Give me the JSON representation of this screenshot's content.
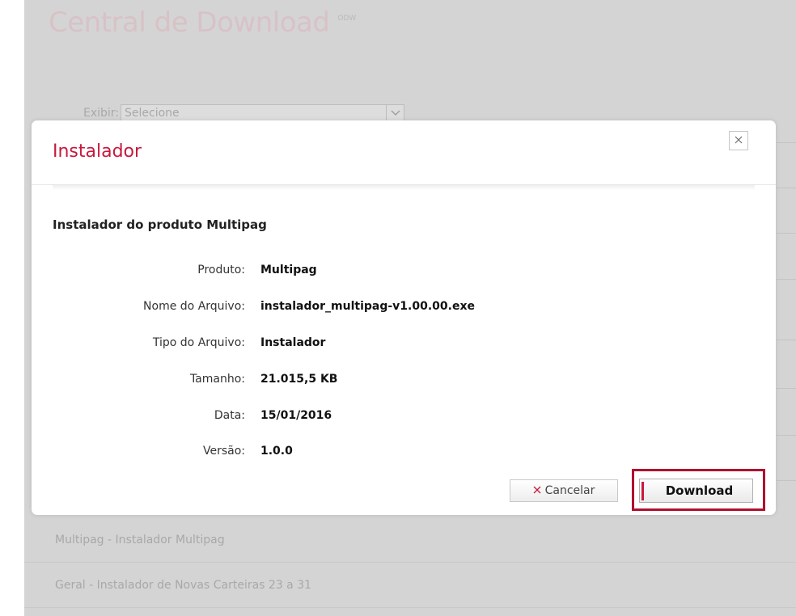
{
  "page": {
    "title": "Central de Download",
    "title_sup": "ODW",
    "filter": {
      "label": "Exibir:",
      "selected": "Selecione"
    },
    "list_items": [
      "Multipag - Instalador Multipag",
      "Geral - Instalador de Novas Carteiras 23 a 31"
    ]
  },
  "modal": {
    "title": "Instalador",
    "close_icon": "close-icon",
    "subtitle": "Instalador do produto Multipag",
    "fields": [
      {
        "label": "Produto:",
        "value": "Multipag"
      },
      {
        "label": "Nome do Arquivo:",
        "value": "instalador_multipag-v1.00.00.exe"
      },
      {
        "label": "Tipo do Arquivo:",
        "value": "Instalador"
      },
      {
        "label": "Tamanho:",
        "value": "21.015,5 KB"
      },
      {
        "label": "Data:",
        "value": "15/01/2016"
      },
      {
        "label": "Versão:",
        "value": "1.0.0"
      }
    ],
    "cancel_label": "Cancelar",
    "download_label": "Download"
  },
  "colors": {
    "accent": "#c8193c",
    "highlight_border": "#b0102f",
    "overlay": "#d4d4d4"
  }
}
